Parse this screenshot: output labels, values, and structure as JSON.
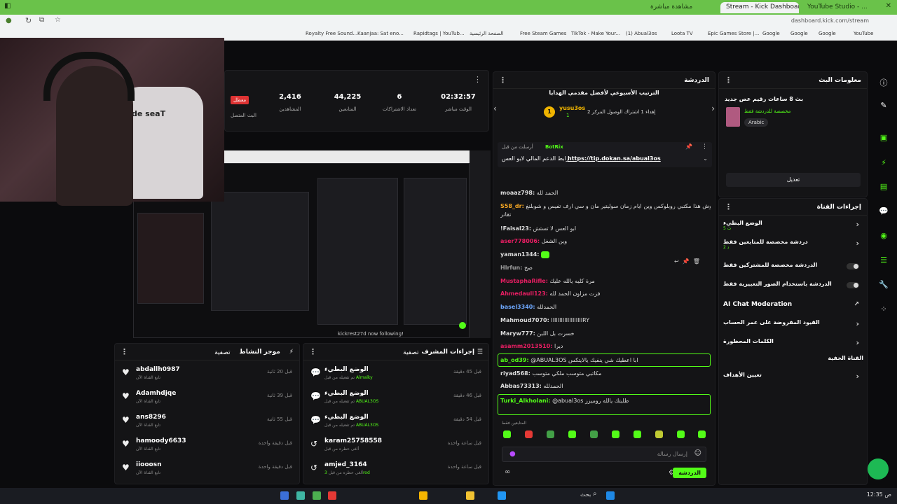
{
  "browser": {
    "tabs": [
      {
        "label": "Stream - Kick Dashboard",
        "active": true
      },
      {
        "label": "YouTube Studio - ..."
      },
      {
        "label": "مشاهدة مباشرة"
      }
    ],
    "url": "dashboard.kick.com/stream",
    "bookmarks": [
      "Royalty Free Sound...",
      "Kaanjaa: Sat eno...",
      "Rapidtags | YouTub...",
      "الصفحة الرئيسية",
      "Free Steam Games",
      "TikTok - Make Your...",
      "(1) Abual3os",
      "Loota TV",
      "Epic Games Store |...",
      "Google",
      "Google",
      "Google",
      "YouTube"
    ]
  },
  "webcam": {
    "chair_brand": "de seaT"
  },
  "stats": {
    "live_badge": "معطل",
    "live_label": "البث المتصل",
    "items": [
      {
        "value": "2,416",
        "label": "المشاهدين"
      },
      {
        "value": "44,225",
        "label": "المتابعين"
      },
      {
        "value": "6",
        "label": "تعداد الاشتراكات"
      },
      {
        "value": "02:32:57",
        "label": "الوقت مباشر"
      }
    ]
  },
  "preview": {
    "overlay": "kickrest27d now following!"
  },
  "activity": {
    "title": "موجز النشاط",
    "filter": "تصفية",
    "rows": [
      {
        "name": "abdallh0987",
        "sub": "تابع القناة الآن",
        "time": "قبل 20 ثانية"
      },
      {
        "name": "Adamhdjqe",
        "sub": "تابع القناة الآن",
        "time": "قبل 39 ثانية"
      },
      {
        "name": "ans8296",
        "sub": "تابع القناة الآن",
        "time": "قبل 55 ثانية"
      },
      {
        "name": "hamoody6633",
        "sub": "تابع القناة الآن",
        "time": "قبل دقيقة واحدة"
      },
      {
        "name": "iiooosn",
        "sub": "تابع القناة الآن",
        "time": "قبل دقيقة واحدة"
      }
    ]
  },
  "mod_actions": {
    "title": "إجراءات المشرف",
    "filter": "تصفية",
    "rows": [
      {
        "name": "الوضع البطيء",
        "sub": "تم تفعيله من قبل",
        "by": "Almalky",
        "time": "قبل 45 دقيقة"
      },
      {
        "name": "الوضع البطيء",
        "sub": "تم تفعيله من قبل",
        "by": "ABUAL3OS",
        "time": "قبل 46 دقيقة"
      },
      {
        "name": "الوضع البطيء",
        "sub": "تم تفعيله من قبل",
        "by": "ABUAL3OS",
        "time": "قبل 54 دقيقة"
      },
      {
        "name": "karam25758558",
        "sub": "ألغى حظره من قبل",
        "by": "",
        "time": "قبل ساعة واحدة"
      },
      {
        "name": "amjed_3164",
        "sub": "ألغى حظره من قبل",
        "by": "3rod",
        "time": "قبل ساعة واحدة"
      }
    ]
  },
  "chat": {
    "title": "الدردشة",
    "leaderboard_title": "الترتيب الأسبوعي لأفضل مقدمي الهدايا",
    "leader_name": "yusu3os",
    "leader_count": "1",
    "leader_line": "إهداء 1 اشتراك الوصول المركز 2",
    "pinned_by": "BotRix",
    "pinned_prefix": "أرسلت من قبل",
    "pinned_text": "رابط الدعم المالي لابو العس",
    "pinned_link": "https://tip.dokan.sa/abual3os",
    "messages": [
      {
        "user": "moaaz798:",
        "text": "الحمد لله",
        "color": "#e0e0e0"
      },
      {
        "user": "S58_dr:",
        "text": "يابو العس وش هذا مكتبي روبلوكس وين ايام زمان سوليتير مان و سي ارف تفيس و شوبلنغ",
        "color": "#f5a623"
      },
      {
        "user": "",
        "text": "تقانر",
        "color": "#e0e0e0"
      },
      {
        "user": "!Faisal23:",
        "text": "ابو العس لا تستش",
        "color": "#e0e0e0"
      },
      {
        "user": "aser778006:",
        "text": "وين الشغل",
        "color": "#e91e63"
      },
      {
        "user": "yaman1344:",
        "text": "",
        "color": "#e0e0e0"
      },
      {
        "user": "Hlrfun:",
        "text": "صح",
        "color": "#9e9e9e"
      },
      {
        "user": "MustaphaRifle:",
        "text": "مرة كليه يالله عليك",
        "color": "#e91e63"
      },
      {
        "user": "Ahmedaull123:",
        "text": "فزت مزاون الحمد لله",
        "color": "#e91e63"
      },
      {
        "user": "basel3340:",
        "text": "الحمدلله",
        "color": "#6ea8fe"
      },
      {
        "user": "Mahmoud7070:",
        "text": "IIIIIIIIIIIIIIIIIIIRY",
        "color": "#e0e0e0"
      },
      {
        "user": "Maryw777:",
        "text": "خسرت بل اللبن",
        "color": "#e0e0e0"
      },
      {
        "user": "asamm2013510:",
        "text": "ديرا",
        "color": "#e91e63"
      },
      {
        "user": "ab_od39:",
        "text": "@ABUAL3OS ابا اعطيك شي ينفيك يالايتكس",
        "color": "#53fc18"
      },
      {
        "user": "riyad568:",
        "text": "مكاتبي متوسب ملكي متوسب",
        "color": "#e0e0e0"
      },
      {
        "user": "Abbas73313:",
        "text": "الحمدلله",
        "color": "#e0e0e0"
      },
      {
        "user": "Turki_Alkholani:",
        "text": "@abual3os طلبتك يالله روميزز",
        "color": "#53fc18"
      }
    ],
    "emote_label": "المتابعين فقط",
    "input_placeholder": "إرسال رسالة",
    "send_label": "الدردشة"
  },
  "stream_info": {
    "title": "معلومات البث",
    "stream_title": "بث 8 ساعات رقيم عص جديد",
    "category": "مخصصة للدردشة فقط",
    "language": "Arabic",
    "edit_label": "تعديل"
  },
  "channel_actions": {
    "title": "إجراءات القناة",
    "rows": [
      {
        "label": "الوضع البطيء",
        "sub": "5 ث",
        "kind": "chevron"
      },
      {
        "label": "دردشة مخصصة للمتابعين فقط",
        "sub": "2 د",
        "kind": "chevron"
      },
      {
        "label": "الدردشة مخصصة للمشتركين فقط",
        "sub": "",
        "kind": "toggle"
      },
      {
        "label": "الدردشة باستخدام الصور التعبيرية فقط",
        "sub": "",
        "kind": "toggle"
      },
      {
        "label": "AI Chat Moderation",
        "sub": "",
        "kind": "link"
      },
      {
        "label": "القيود المفروضة على عمر الحساب",
        "sub": "",
        "kind": "chevron"
      },
      {
        "label": "الكلمات المحظورة",
        "sub": "",
        "kind": "chevron"
      },
      {
        "label": "القناة الخفية",
        "sub": "",
        "kind": "none"
      },
      {
        "label": "تعيين الأهداف",
        "sub": "",
        "kind": "chevron"
      }
    ]
  },
  "taskbar": {
    "search": "بحث",
    "time": "12:35 ص"
  },
  "colors": {
    "accent": "#53fc18",
    "panel": "#141416",
    "bg": "#0b0b0d",
    "live": "#dd3333"
  }
}
